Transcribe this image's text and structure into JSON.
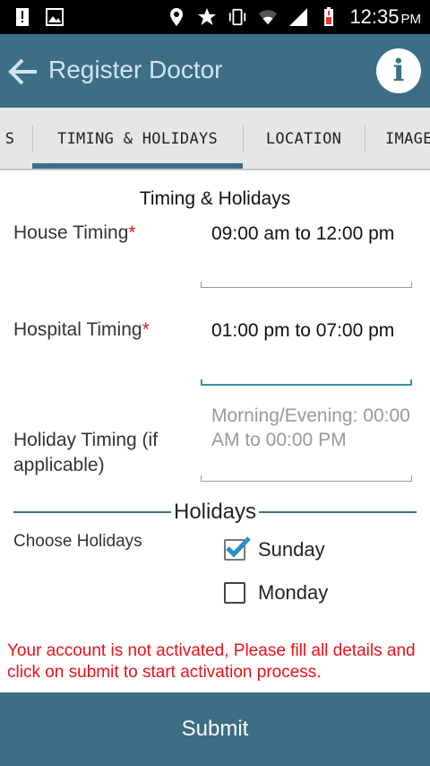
{
  "status_bar": {
    "time": "12:35",
    "ampm": "PM",
    "icons": [
      "alert-icon",
      "image-icon",
      "location-icon",
      "star-icon",
      "vibrate-icon",
      "wifi-icon",
      "signal-icon",
      "battery-low-icon"
    ]
  },
  "app_bar": {
    "title": "Register Doctor",
    "back_icon": "back-arrow-icon",
    "info_icon": "info-icon",
    "info_glyph": "i"
  },
  "tabs": [
    {
      "label": "S"
    },
    {
      "label": "TIMING & HOLIDAYS",
      "active": true
    },
    {
      "label": "LOCATION"
    },
    {
      "label": "IMAGE"
    }
  ],
  "form": {
    "section_title": "Timing & Holidays",
    "house_timing": {
      "label": "House Timing",
      "required": "*",
      "value": "09:00 am to 12:00 pm"
    },
    "hospital_timing": {
      "label": "Hospital Timing",
      "required": "*",
      "value": "01:00 pm to 07:00 pm"
    },
    "holiday_timing": {
      "label": "Holiday Timing (if applicable)",
      "placeholder": "Morning/Evening: 00:00 AM to 00:00 PM"
    },
    "holidays_header": "Holidays",
    "choose_holidays_label": "Choose Holidays",
    "days": [
      {
        "label": "Sunday",
        "checked": true
      },
      {
        "label": "Monday",
        "checked": false
      }
    ]
  },
  "message": "Your account is not activated, Please fill all details and click on submit to start activation process.",
  "submit_label": "Submit",
  "colors": {
    "primary": "#3c6e86",
    "error": "#e8101a",
    "checkbox_accent": "#2a8fc4"
  }
}
